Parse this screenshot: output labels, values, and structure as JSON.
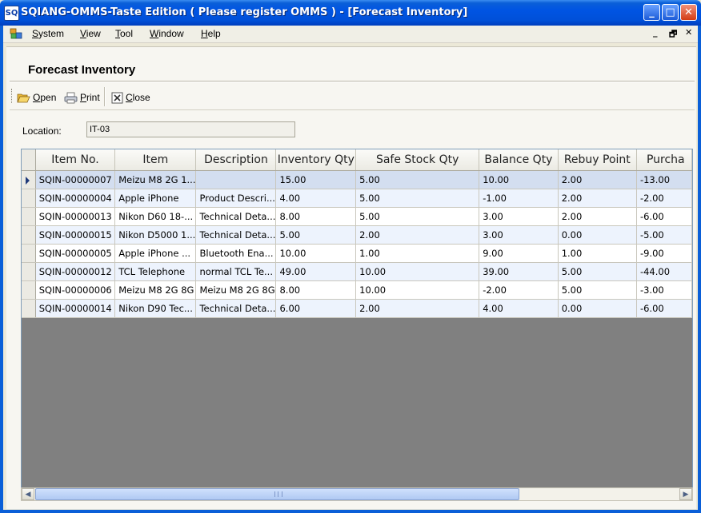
{
  "window": {
    "app_icon": "SQ",
    "title": "SQIANG-OMMS-Taste Edition ( Please register OMMS ) - [Forecast Inventory]",
    "controls": {
      "minimize": "_",
      "maximize": "□",
      "close": "✕"
    }
  },
  "menubar": {
    "items": [
      {
        "label_pre": "",
        "mnemonic": "S",
        "label_post": "ystem"
      },
      {
        "label_pre": "",
        "mnemonic": "V",
        "label_post": "iew"
      },
      {
        "label_pre": "",
        "mnemonic": "T",
        "label_post": "ool"
      },
      {
        "label_pre": "",
        "mnemonic": "W",
        "label_post": "indow"
      },
      {
        "label_pre": "",
        "mnemonic": "H",
        "label_post": "elp"
      }
    ],
    "mdi_controls": {
      "minimize": "_",
      "restore": "🗗",
      "close": "✕"
    }
  },
  "page": {
    "title": "Forecast Inventory"
  },
  "toolbar": {
    "open": {
      "mnemonic": "O",
      "rest": "pen",
      "icon": "folder-open-icon"
    },
    "print": {
      "mnemonic": "P",
      "rest": "rint",
      "icon": "printer-icon"
    },
    "close": {
      "mnemonic": "C",
      "rest": "lose",
      "icon": "close-box-icon"
    }
  },
  "filter": {
    "location_label": "Location:",
    "location_value": "IT-03"
  },
  "grid": {
    "columns": [
      "Item No.",
      "Item",
      "Description",
      "Inventory Qty",
      "Safe Stock Qty",
      "Balance Qty",
      "Rebuy Point",
      "Purcha"
    ],
    "rows": [
      [
        "SQIN-00000007",
        "Meizu M8 2G 1...",
        "",
        "15.00",
        "5.00",
        "10.00",
        "2.00",
        "-13.00"
      ],
      [
        "SQIN-00000004",
        "Apple iPhone",
        "Product Descri...",
        "4.00",
        "5.00",
        "-1.00",
        "2.00",
        "-2.00"
      ],
      [
        "SQIN-00000013",
        "Nikon D60 18-...",
        "Technical Deta...",
        "8.00",
        "5.00",
        "3.00",
        "2.00",
        "-6.00"
      ],
      [
        "SQIN-00000015",
        "Nikon D5000 1...",
        "Technical Deta...",
        "5.00",
        "2.00",
        "3.00",
        "0.00",
        "-5.00"
      ],
      [
        "SQIN-00000005",
        "Apple iPhone ...",
        "Bluetooth Ena...",
        "10.00",
        "1.00",
        "9.00",
        "1.00",
        "-9.00"
      ],
      [
        "SQIN-00000012",
        "TCL Telephone",
        "normal TCL Te...",
        "49.00",
        "10.00",
        "39.00",
        "5.00",
        "-44.00"
      ],
      [
        "SQIN-00000006",
        "Meizu M8 2G 8G",
        "Meizu M8 2G 8G",
        "8.00",
        "10.00",
        "-2.00",
        "5.00",
        "-3.00"
      ],
      [
        "SQIN-00000014",
        "Nikon D90 Tec...",
        "Technical Deta...",
        "6.00",
        "2.00",
        "4.00",
        "0.00",
        "-6.00"
      ]
    ],
    "selected_row": 0
  },
  "scrollbar": {
    "left_arrow": "◀",
    "right_arrow": "▶"
  }
}
